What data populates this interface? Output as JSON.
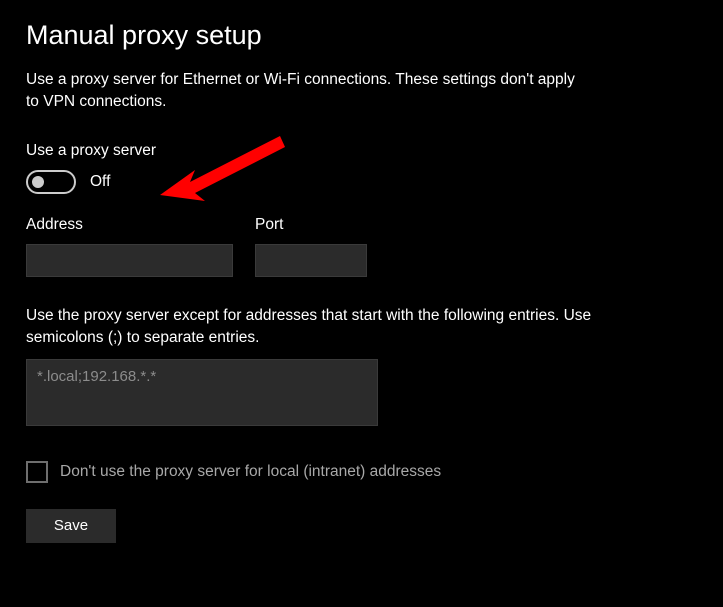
{
  "title": "Manual proxy setup",
  "description": "Use a proxy server for Ethernet or Wi-Fi connections. These settings don't apply to VPN connections.",
  "toggle": {
    "label": "Use a proxy server",
    "state": "Off"
  },
  "address": {
    "label": "Address",
    "value": ""
  },
  "port": {
    "label": "Port",
    "value": ""
  },
  "exceptions": {
    "label": "Use the proxy server except for addresses that start with the following entries. Use semicolons (;) to separate entries.",
    "value": "*.local;192.168.*.*"
  },
  "local_bypass": {
    "label": "Don't use the proxy server for local (intranet) addresses",
    "checked": false
  },
  "save_label": "Save",
  "annotation": {
    "arrow_color": "#ff0000"
  }
}
